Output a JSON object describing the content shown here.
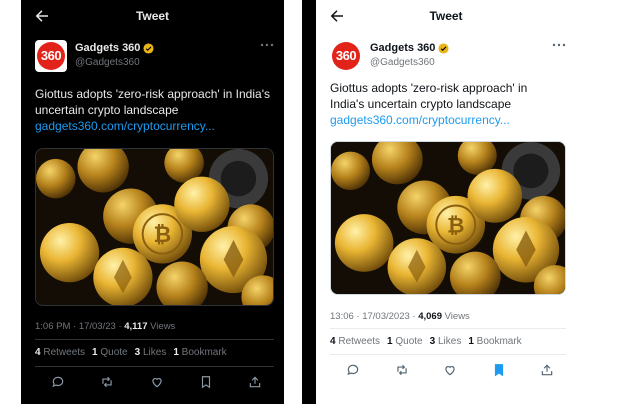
{
  "left_tweet": {
    "header_title": "Tweet",
    "display_name": "Gadgets 360",
    "handle": "@Gadgets360",
    "avatar_text": "360",
    "text": "Giottus adopts 'zero-risk approach' in India's uncertain crypto landscape",
    "link": "gadgets360.com/cryptocurrency...",
    "meta_time": "1:06 PM · 17/03/23 · ",
    "views_count": "4,117",
    "views_label": " Views",
    "stats": [
      {
        "count": "4",
        "label": "Retweets"
      },
      {
        "count": "1",
        "label": "Quote"
      },
      {
        "count": "3",
        "label": "Likes"
      },
      {
        "count": "1",
        "label": "Bookmark"
      }
    ],
    "actions": [
      "reply-icon",
      "retweet-icon",
      "like-icon",
      "bookmark-icon",
      "share-icon"
    ],
    "theme": {
      "background": "#000000",
      "text": "#e7e9ea",
      "link": "#1d9bf0"
    }
  },
  "right_tweet": {
    "header_title": "Tweet",
    "display_name": "Gadgets 360",
    "handle": "@Gadgets360",
    "avatar_text": "360",
    "text": "Giottus adopts 'zero-risk approach' in India's uncertain crypto landscape",
    "link": "gadgets360.com/cryptocurrency...",
    "meta_time": "13:06 · 17/03/2023 · ",
    "views_count": "4,069",
    "views_label": " Views",
    "stats": [
      {
        "count": "4",
        "label": "Retweets"
      },
      {
        "count": "1",
        "label": "Quote"
      },
      {
        "count": "3",
        "label": "Likes"
      },
      {
        "count": "1",
        "label": "Bookmark"
      }
    ],
    "actions": [
      "reply-icon",
      "retweet-icon",
      "like-icon",
      "bookmark-icon-filled",
      "share-icon"
    ],
    "theme": {
      "background": "#ffffff",
      "text": "#0f1419",
      "link": "#1d9bf0",
      "bookmark_active": "#1d9bf0"
    }
  },
  "colors": {
    "verified_badge": "#e8b417",
    "avatar_red": "#e2231a",
    "muted": "#71767b"
  }
}
